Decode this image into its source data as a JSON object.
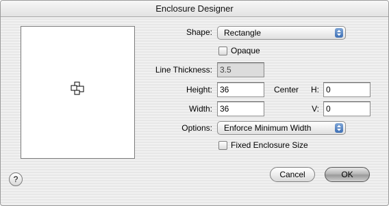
{
  "window": {
    "title": "Enclosure Designer"
  },
  "labels": {
    "shape": "Shape:",
    "line_thickness": "Line Thickness:",
    "height": "Height:",
    "width": "Width:",
    "center": "Center",
    "h": "H:",
    "v": "V:",
    "options": "Options:"
  },
  "shape_popup": {
    "value": "Rectangle"
  },
  "options_popup": {
    "value": "Enforce Minimum Width"
  },
  "checkboxes": {
    "opaque": {
      "label": "Opaque",
      "checked": false
    },
    "fixed_size": {
      "label": "Fixed Enclosure Size",
      "checked": false
    }
  },
  "fields": {
    "line_thickness": "3.5",
    "height": "36",
    "width": "36",
    "center_h": "0",
    "center_v": "0"
  },
  "buttons": {
    "cancel": "Cancel",
    "ok": "OK",
    "help": "?"
  },
  "icons": {
    "preview": "enclosure-preview-icon",
    "popup_arrows": "updown-arrows-icon"
  }
}
